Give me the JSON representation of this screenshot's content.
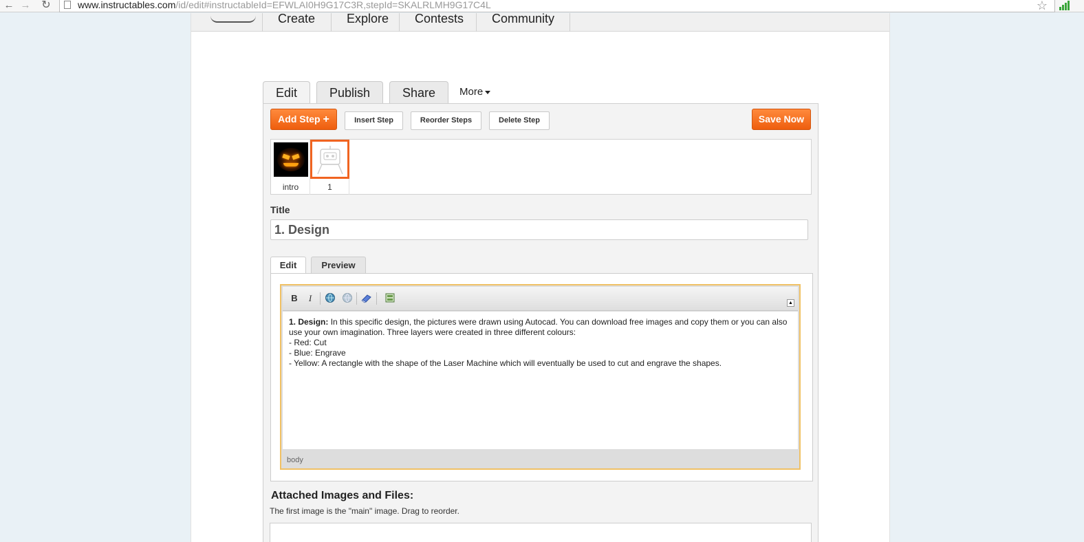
{
  "browser": {
    "url_host": "www.instructables.com",
    "url_path": "/id/edit#instructableId=EFWLAI0H9G17C3R,stepId=SKALRLMH9G17C4L"
  },
  "site_nav": {
    "items": [
      "Create",
      "Explore",
      "Contests",
      "Community"
    ]
  },
  "top_tabs": {
    "edit": "Edit",
    "publish": "Publish",
    "share": "Share",
    "more": "More"
  },
  "toolbar": {
    "add_step": "Add Step",
    "add_step_plus": "+",
    "insert_step": "Insert Step",
    "reorder_steps": "Reorder Steps",
    "delete_step": "Delete Step",
    "save_now": "Save Now"
  },
  "steps": [
    {
      "label": "intro",
      "thumb": "jack-o-lantern-photo"
    },
    {
      "label": "1",
      "thumb": "robot-placeholder",
      "selected": true
    }
  ],
  "title_field": {
    "label": "Title",
    "value": "1. Design"
  },
  "editor_tabs": {
    "edit": "Edit",
    "preview": "Preview"
  },
  "rte": {
    "toolbar_icons": [
      "bold-icon",
      "italic-icon",
      "insert-link-icon",
      "unlink-icon",
      "eraser-icon",
      "insert-media-icon"
    ],
    "bold_label": "B",
    "italic_label": "I",
    "content": {
      "heading": "1. Design:",
      "intro": " In this specific design, the pictures were drawn using Autocad. You can download free images and copy them or you can also use your own imagination.  Three layers were created in three different colours:",
      "line_red": "- Red: Cut",
      "line_blue": "- Blue: Engrave",
      "line_yellow": "- Yellow: A rectangle with the shape of the Laser Machine which will eventually be used to cut and engrave the shapes."
    },
    "path": "body"
  },
  "attachments": {
    "title": "Attached Images and Files:",
    "hint": "The first image is the \"main\" image. Drag to reorder."
  },
  "colors": {
    "accent_orange": "#f06421",
    "editor_focus_border": "#f0c165"
  }
}
